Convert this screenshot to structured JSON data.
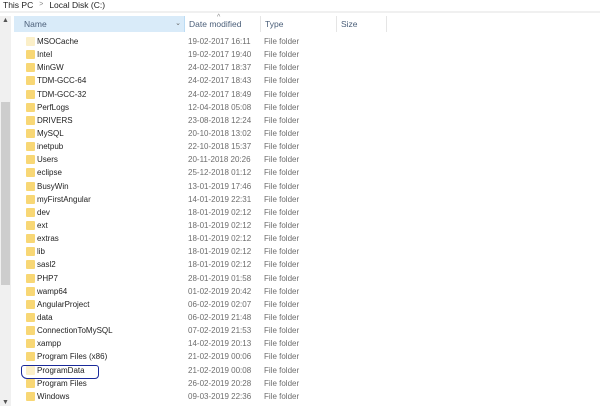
{
  "breadcrumb": [
    "This PC",
    "Local Disk (C:)"
  ],
  "columns": {
    "name": "Name",
    "date": "Date modified",
    "type": "Type",
    "size": "Size"
  },
  "files": [
    {
      "name": "MSOCache",
      "date": "19-02-2017 16:11",
      "type": "File folder",
      "hidden": true
    },
    {
      "name": "Intel",
      "date": "19-02-2017 19:40",
      "type": "File folder"
    },
    {
      "name": "MinGW",
      "date": "24-02-2017 18:37",
      "type": "File folder"
    },
    {
      "name": "TDM-GCC-64",
      "date": "24-02-2017 18:43",
      "type": "File folder"
    },
    {
      "name": "TDM-GCC-32",
      "date": "24-02-2017 18:49",
      "type": "File folder"
    },
    {
      "name": "PerfLogs",
      "date": "12-04-2018 05:08",
      "type": "File folder"
    },
    {
      "name": "DRIVERS",
      "date": "23-08-2018 12:24",
      "type": "File folder"
    },
    {
      "name": "MySQL",
      "date": "20-10-2018 13:02",
      "type": "File folder"
    },
    {
      "name": "inetpub",
      "date": "22-10-2018 15:37",
      "type": "File folder"
    },
    {
      "name": "Users",
      "date": "20-11-2018 20:26",
      "type": "File folder"
    },
    {
      "name": "eclipse",
      "date": "25-12-2018 01:12",
      "type": "File folder"
    },
    {
      "name": "BusyWin",
      "date": "13-01-2019 17:46",
      "type": "File folder"
    },
    {
      "name": "myFirstAngular",
      "date": "14-01-2019 22:31",
      "type": "File folder"
    },
    {
      "name": "dev",
      "date": "18-01-2019 02:12",
      "type": "File folder"
    },
    {
      "name": "ext",
      "date": "18-01-2019 02:12",
      "type": "File folder"
    },
    {
      "name": "extras",
      "date": "18-01-2019 02:12",
      "type": "File folder"
    },
    {
      "name": "lib",
      "date": "18-01-2019 02:12",
      "type": "File folder"
    },
    {
      "name": "sasl2",
      "date": "18-01-2019 02:12",
      "type": "File folder"
    },
    {
      "name": "PHP7",
      "date": "28-01-2019 01:58",
      "type": "File folder"
    },
    {
      "name": "wamp64",
      "date": "01-02-2019 20:42",
      "type": "File folder"
    },
    {
      "name": "AngularProject",
      "date": "06-02-2019 02:07",
      "type": "File folder"
    },
    {
      "name": "data",
      "date": "06-02-2019 21:48",
      "type": "File folder"
    },
    {
      "name": "ConnectionToMySQL",
      "date": "07-02-2019 21:53",
      "type": "File folder"
    },
    {
      "name": "xampp",
      "date": "14-02-2019 20:13",
      "type": "File folder"
    },
    {
      "name": "Program Files (x86)",
      "date": "21-02-2019 00:06",
      "type": "File folder"
    },
    {
      "name": "ProgramData",
      "date": "21-02-2019 00:08",
      "type": "File folder",
      "hidden": true
    },
    {
      "name": "Program Files",
      "date": "26-02-2019 20:28",
      "type": "File folder"
    },
    {
      "name": "Windows",
      "date": "09-03-2019 22:36",
      "type": "File folder"
    }
  ]
}
